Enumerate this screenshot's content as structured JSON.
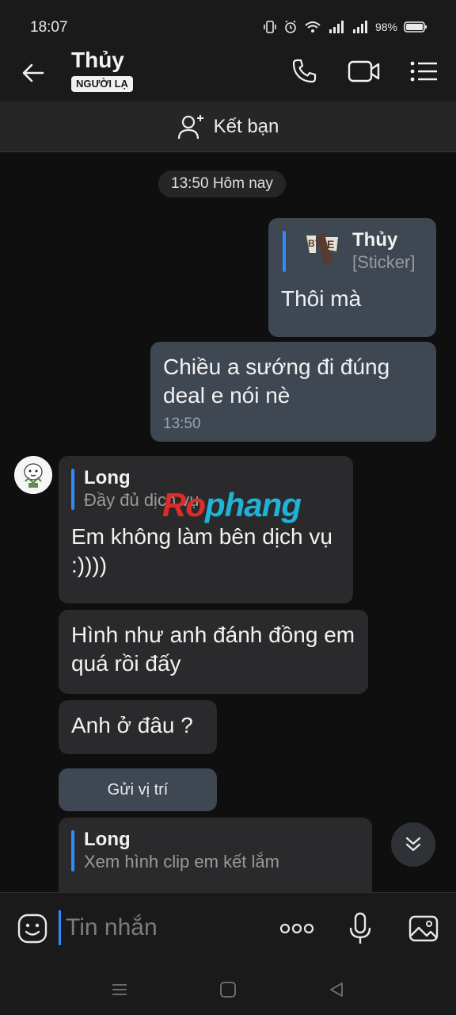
{
  "status_bar": {
    "time": "18:07",
    "battery": "98%"
  },
  "header": {
    "contact_name": "Thủy",
    "badge": "NGƯỜI LẠ",
    "icons": [
      "back-arrow-icon",
      "phone-icon",
      "video-call-icon",
      "menu-list-icon"
    ]
  },
  "add_friend": {
    "label": "Kết bạn"
  },
  "chat": {
    "timestamp": "13:50 Hôm nay",
    "messages": [
      {
        "direction": "outgoing",
        "quote_name": "Thủy",
        "quote_text": "[Sticker]",
        "text": "Thôi mà"
      },
      {
        "direction": "outgoing",
        "text": "Chiều a sướng đi đúng deal e nói nè",
        "time": "13:50"
      },
      {
        "direction": "incoming",
        "quote_name": "Long",
        "quote_text": "Đầy đủ dịch vụ",
        "text": "Em không làm bên dịch vụ :))))"
      },
      {
        "direction": "incoming",
        "text": "Hình như anh đánh đồng em quá rồi đấy"
      },
      {
        "direction": "incoming",
        "text": "Anh ở đâu ?"
      },
      {
        "direction": "incoming",
        "quote_name": "Long",
        "quote_text": "Xem hình clip em kết lắm"
      }
    ],
    "location_button": "Gửi vị trí",
    "watermark": {
      "part1": "Ro",
      "part2": "phang"
    }
  },
  "input_bar": {
    "placeholder": "Tin nhắn"
  },
  "colors": {
    "accent": "#2f8bff",
    "outgoing_bubble": "#3f4753",
    "incoming_bubble": "#2a2a2c",
    "background": "#0f0f10"
  }
}
